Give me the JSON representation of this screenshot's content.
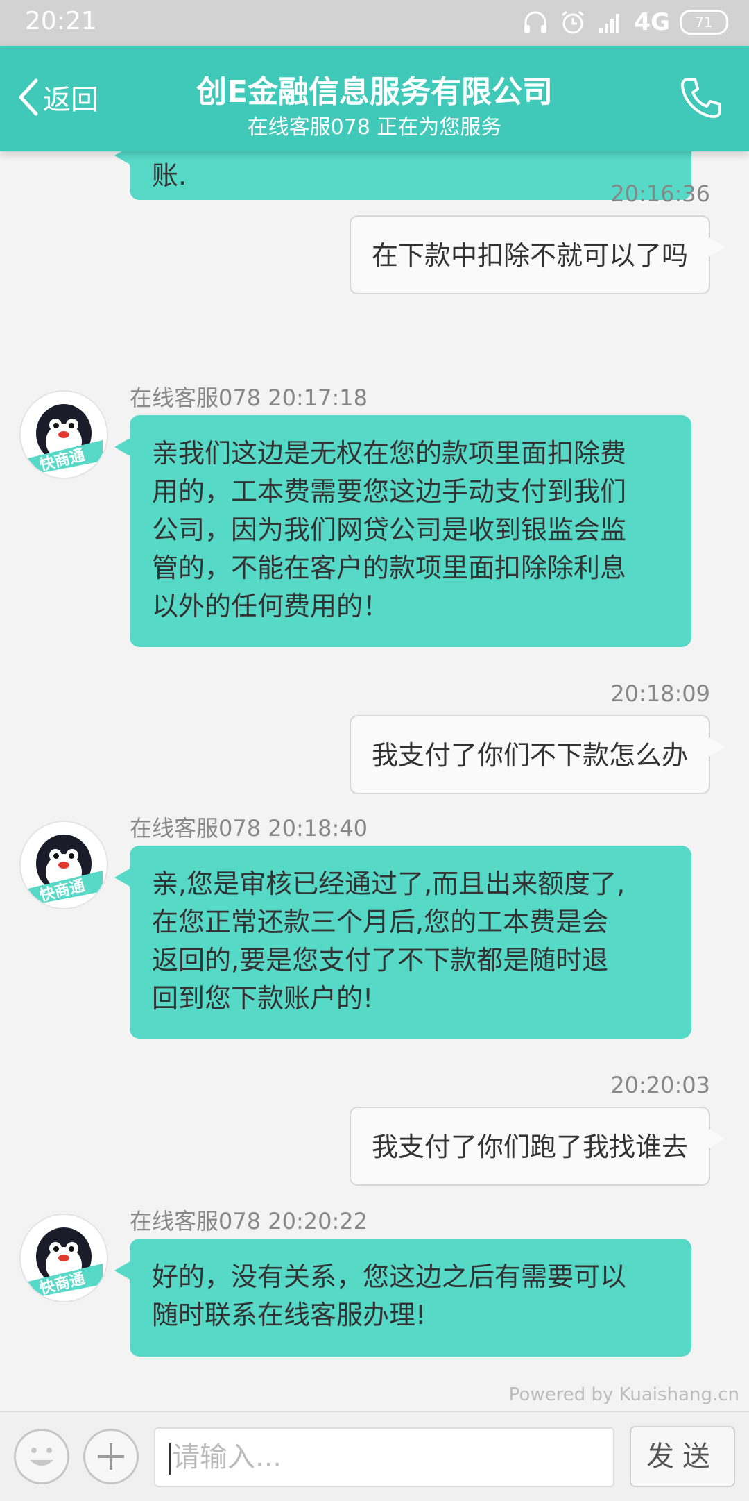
{
  "status_bar": {
    "time": "20:21",
    "network": "4G",
    "battery": "71"
  },
  "header": {
    "back_label": "返回",
    "title": "创E金融信息服务有限公司",
    "subtitle": "在线客服078 正在为您服务"
  },
  "messages": {
    "partial": {
      "text": "账."
    },
    "m1": {
      "time": "20:16:36",
      "text": "在下款中扣除不就可以了吗"
    },
    "m2": {
      "meta": "在线客服078  20:17:18",
      "lines": [
        "亲我们这边是无权在您的款项里面扣除费",
        "用的，工本费需要您这边手动支付到我们",
        "公司，因为我们网贷公司是收到银监会监",
        "管的，不能在客户的款项里面扣除除利息",
        "以外的任何费用的！"
      ]
    },
    "m3": {
      "time": "20:18:09",
      "text": "我支付了你们不下款怎么办"
    },
    "m4": {
      "meta": "在线客服078  20:18:40",
      "lines": [
        "亲,您是审核已经通过了,而且出来额度了,",
        "在您正常还款三个月后,您的工本费是会",
        "返回的,要是您支付了不下款都是随时退",
        "回到您下款账户的!"
      ]
    },
    "m5": {
      "time": "20:20:03",
      "text": "我支付了你们跑了我找谁去"
    },
    "m6": {
      "meta": "在线客服078  20:20:22",
      "lines": [
        "好的，没有关系，您这边之后有需要可以",
        "随时联系在线客服办理!"
      ]
    }
  },
  "avatar_badge": "快商通",
  "powered_by": "Powered by Kuaishang.cn",
  "input": {
    "placeholder": "请输入..."
  },
  "send_label": "发送",
  "colors": {
    "accent": "#40c9b8",
    "bubble_in": "#57d9c7",
    "bubble_out": "#fafafa"
  }
}
